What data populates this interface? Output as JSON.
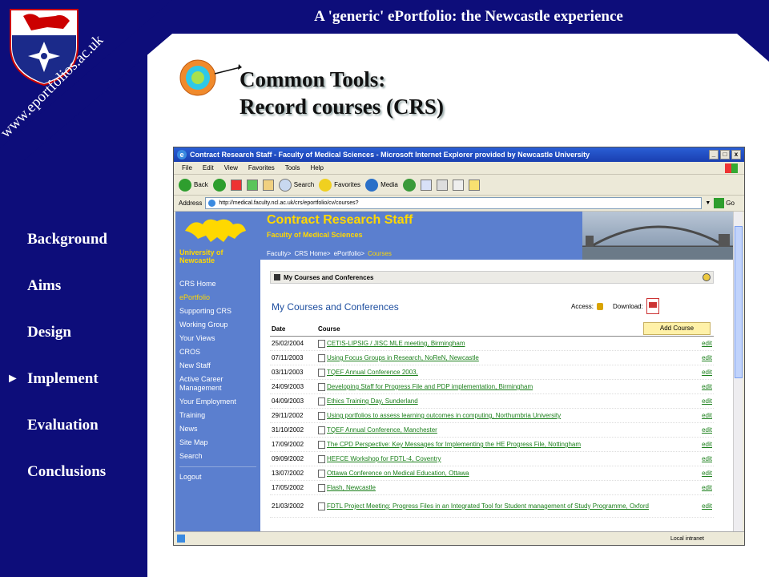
{
  "slide_title": "A 'generic' ePortfolio: the Newcastle experience",
  "website": "www.eportfolios.ac.uk",
  "nav": {
    "items": [
      "Background",
      "Aims",
      "Design",
      "Implement",
      "Evaluation",
      "Conclusions"
    ],
    "current": "Implement",
    "current_marker": "►"
  },
  "heading": {
    "line1": "Common Tools:",
    "line2": "Record courses (CRS)"
  },
  "colors": {
    "navy": "#0d0d7a",
    "site_blue": "#5b7fcf",
    "site_yellow": "#ffd800",
    "link_green": "#1a7f1a"
  },
  "browser": {
    "title": "Contract Research Staff - Faculty of Medical Sciences - Microsoft Internet Explorer provided by Newcastle University",
    "menu": [
      "File",
      "Edit",
      "View",
      "Favorites",
      "Tools",
      "Help"
    ],
    "toolbar": {
      "back": "Back",
      "search": "Search",
      "favorites": "Favorites",
      "media": "Media"
    },
    "address_label": "Address",
    "address": "http://medical.faculty.ncl.ac.uk/crs/eportfolio/cv/courses?",
    "go": "Go",
    "status_zone": "Local intranet"
  },
  "site": {
    "title": "Contract Research Staff",
    "subtitle": "Faculty of Medical Sciences",
    "university": "University of Newcastle",
    "breadcrumb": [
      "Faculty>",
      "CRS Home>",
      "ePortfolio>",
      "Courses"
    ],
    "side_nav": [
      "CRS Home",
      "ePortfolio",
      "Supporting CRS",
      "Working Group",
      "Your Views",
      "CROS",
      "New Staff",
      "Active Career Management",
      "Your Employment",
      "Training",
      "News",
      "Site Map",
      "Search"
    ],
    "side_nav_active": "ePortfolio",
    "logout": "Logout"
  },
  "panel": {
    "header": "My Courses and Conferences",
    "title": "My Courses and Conferences",
    "access_label": "Access:",
    "download_label": "Download:",
    "col_date": "Date",
    "col_course": "Course",
    "add_button": "Add Course",
    "edit_label": "edit",
    "rows": [
      {
        "date": "25/02/2004",
        "course": "CETIS-LIPSIG / JISC MLE meeting, Birmingham"
      },
      {
        "date": "07/11/2003",
        "course": "Using Focus Groups in Research, NoReN, Newcastle"
      },
      {
        "date": "03/11/2003",
        "course": "TQEF Annual Conference 2003,"
      },
      {
        "date": "24/09/2003",
        "course": "Developing Staff for Progress File and PDP implementation, Birmingham"
      },
      {
        "date": "04/09/2003",
        "course": "Ethics Training Day, Sunderland"
      },
      {
        "date": "29/11/2002",
        "course": "Using portfolios to assess learning outcomes in computing, Northumbria University"
      },
      {
        "date": "31/10/2002",
        "course": "TQEF Annual Conference, Manchester"
      },
      {
        "date": "17/09/2002",
        "course": "The CPD Perspective: Key Messages for Implementing the HE Progress File, Nottingham"
      },
      {
        "date": "09/09/2002",
        "course": "HEFCE Workshop for FDTL-4, Coventry"
      },
      {
        "date": "13/07/2002",
        "course": "Ottawa Conference on Medical Education, Ottawa"
      },
      {
        "date": "17/05/2002",
        "course": "Flash, Newcastle"
      },
      {
        "date": "21/03/2002",
        "course": "FDTL Project Meeting: Progress Files in an Integrated Tool for Student management of Study Programme, Oxford"
      }
    ]
  }
}
